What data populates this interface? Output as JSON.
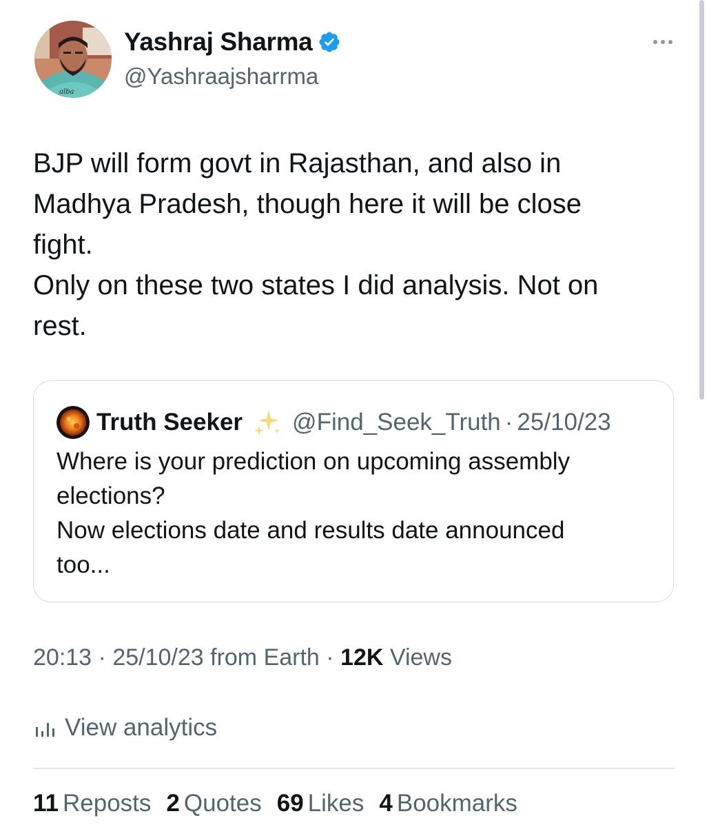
{
  "author": {
    "name": "Yashraj Sharma",
    "handle": "@Yashraajsharrma",
    "verified_icon": "verified-badge-icon",
    "avatar_icon": "profile-photo"
  },
  "more_icon": "more-horizontal-icon",
  "tweet": {
    "text": "BJP will form govt in Rajasthan, and also in\nMadhya Pradesh, though here it will be close\nfight.\nOnly on these two states I did analysis. Not on\nrest."
  },
  "quoted": {
    "name": "Truth Seeker",
    "emoji_icon": "sparkles-icon",
    "handle": "@Find_Seek_Truth",
    "separator": "·",
    "date": "25/10/23",
    "text": "Where is your prediction on upcoming assembly\nelections?\nNow elections date and results date announced\ntoo..."
  },
  "meta": {
    "time": "20:13",
    "sep1": " · ",
    "date": "25/10/23",
    "source": " from Earth",
    "sep2": " · ",
    "views_count": "12K",
    "views_label": " Views"
  },
  "analytics": {
    "label": "View analytics",
    "icon": "analytics-bars-icon"
  },
  "stats": [
    {
      "num": "11",
      "label": "Reposts"
    },
    {
      "num": "2",
      "label": "Quotes"
    },
    {
      "num": "69",
      "label": "Likes"
    },
    {
      "num": "4",
      "label": "Bookmarks"
    }
  ],
  "colors": {
    "text": "#0f1419",
    "secondary": "#536471",
    "verified": "#1d9bf0",
    "border": "#d4dbe1"
  }
}
